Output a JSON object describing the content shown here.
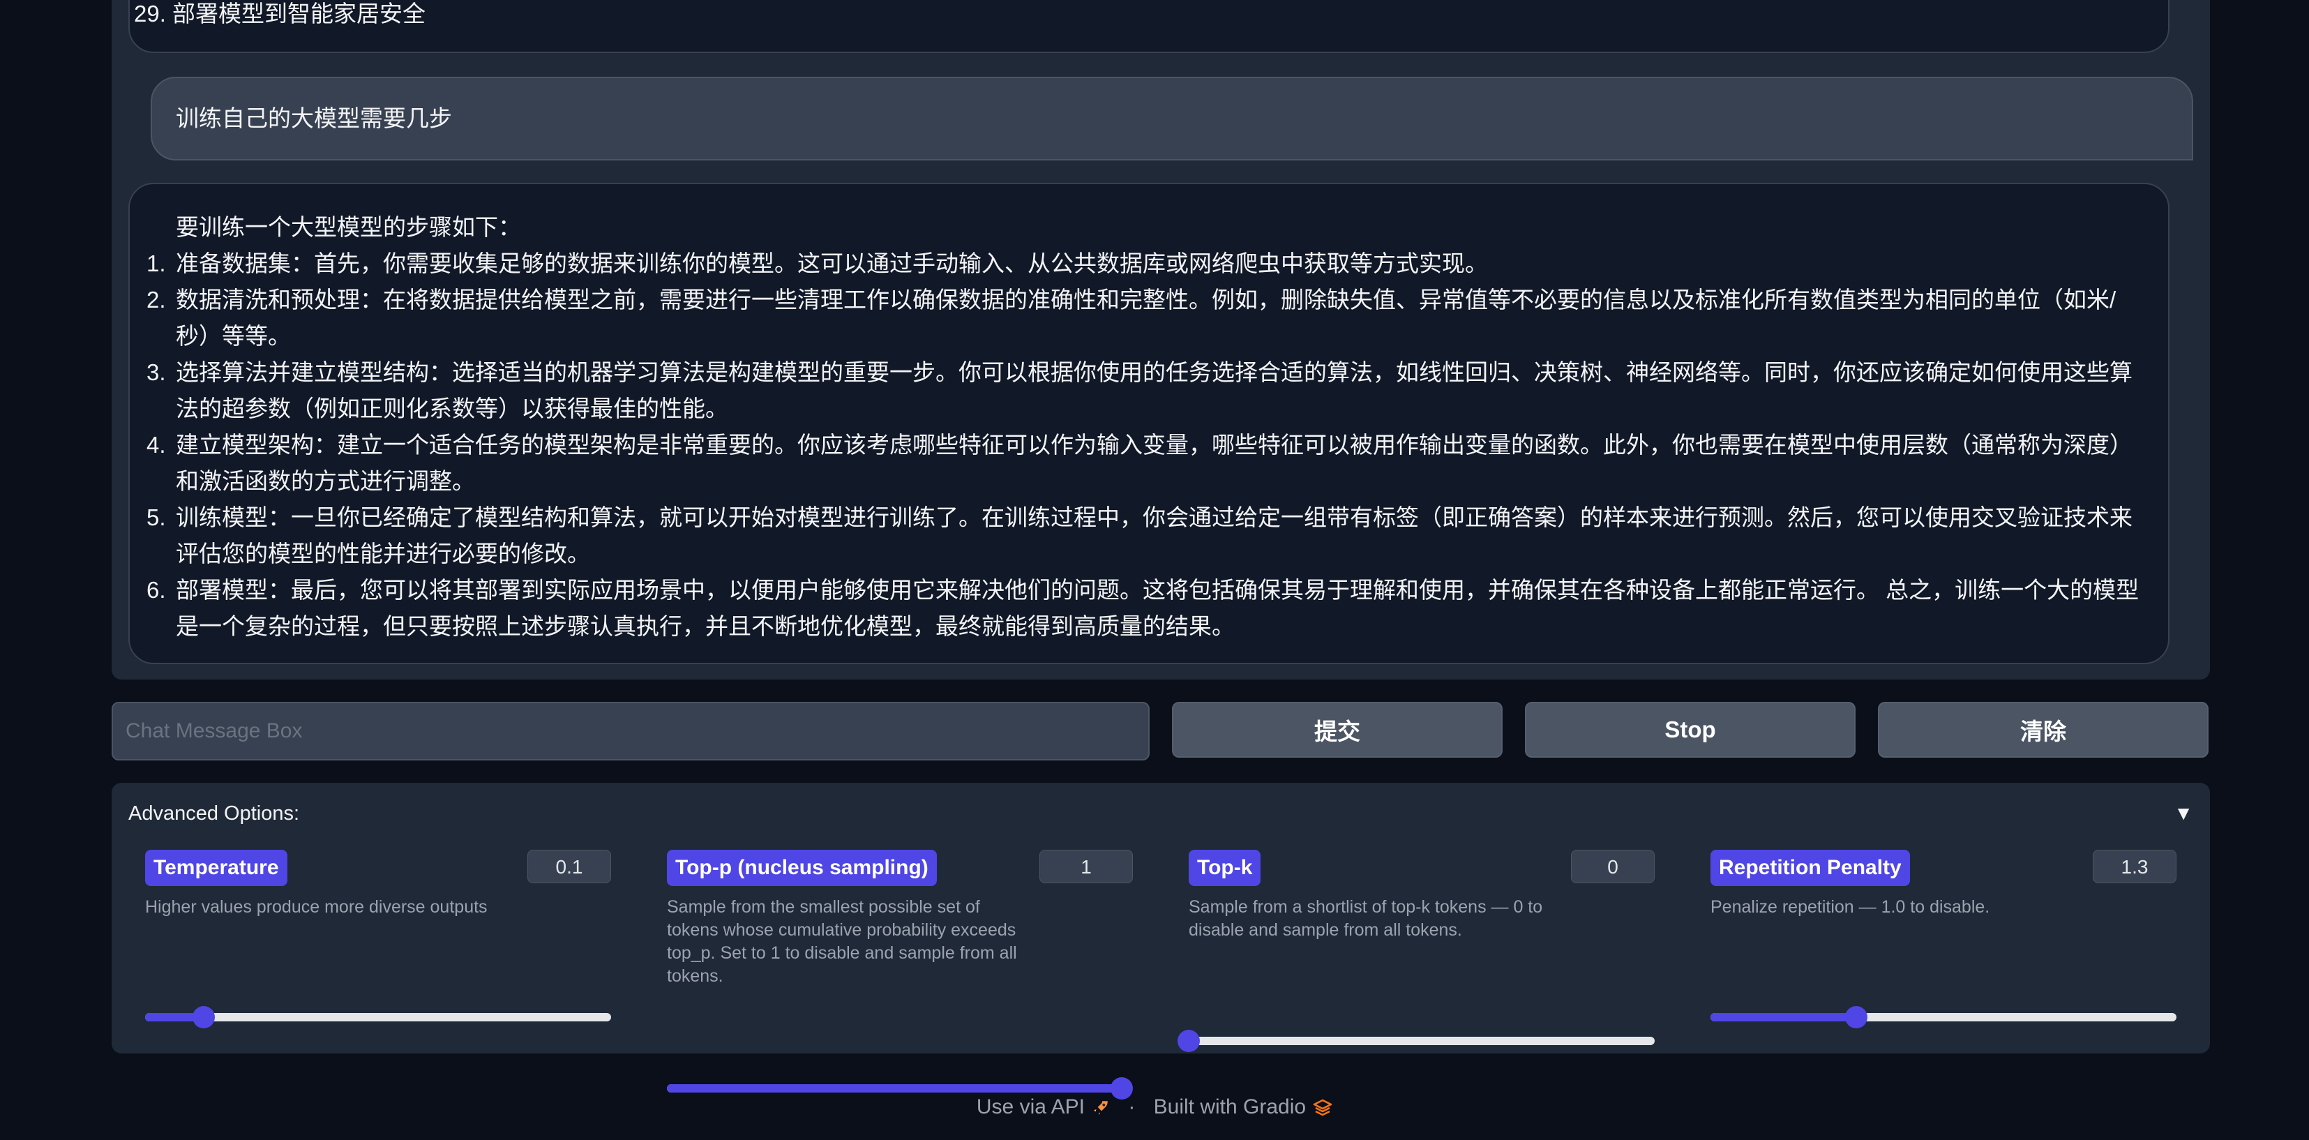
{
  "chat": {
    "prev_bot_line": "29. 部署模型到智能家居安全",
    "user_message": "训练自己的大模型需要几步",
    "bot_reply": {
      "intro": "要训练一个大型模型的步骤如下：",
      "steps": [
        {
          "num": "1.",
          "text": "准备数据集：首先，你需要收集足够的数据来训练你的模型。这可以通过手动输入、从公共数据库或网络爬虫中获取等方式实现。"
        },
        {
          "num": "2.",
          "text": "数据清洗和预处理：在将数据提供给模型之前，需要进行一些清理工作以确保数据的准确性和完整性。例如，删除缺失值、异常值等不必要的信息以及标准化所有数值类型为相同的单位（如米/秒）等等。"
        },
        {
          "num": "3.",
          "text": "选择算法并建立模型结构：选择适当的机器学习算法是构建模型的重要一步。你可以根据你使用的任务选择合适的算法，如线性回归、决策树、神经网络等。同时，你还应该确定如何使用这些算法的超参数（例如正则化系数等）以获得最佳的性能。"
        },
        {
          "num": "4.",
          "text": "建立模型架构：建立一个适合任务的模型架构是非常重要的。你应该考虑哪些特征可以作为输入变量，哪些特征可以被用作输出变量的函数。此外，你也需要在模型中使用层数（通常称为深度）和激活函数的方式进行调整。"
        },
        {
          "num": "5.",
          "text": "训练模型：一旦你已经确定了模型结构和算法，就可以开始对模型进行训练了。在训练过程中，你会通过给定一组带有标签（即正确答案）的样本来进行预测。然后，您可以使用交叉验证技术来评估您的模型的性能并进行必要的修改。"
        },
        {
          "num": "6.",
          "text": "部署模型：最后，您可以将其部署到实际应用场景中，以便用户能够使用它来解决他们的问题。这将包括确保其易于理解和使用，并确保其在各种设备上都能正常运行。 总之，训练一个大的模型是一个复杂的过程，但只要按照上述步骤认真执行，并且不断地优化模型，最终就能得到高质量的结果。"
        }
      ]
    }
  },
  "input": {
    "placeholder": "Chat Message Box",
    "value": ""
  },
  "buttons": {
    "submit": "提交",
    "stop": "Stop",
    "clear": "清除"
  },
  "advanced": {
    "title": "Advanced Options:",
    "toggle": "▼",
    "sliders": [
      {
        "key": "temperature",
        "label": "Temperature",
        "value": "0.1",
        "fraction": 0.125,
        "description": "Higher values produce more diverse outputs"
      },
      {
        "key": "top_p",
        "label": "Top-p (nucleus sampling)",
        "value": "1",
        "fraction": 1.0,
        "description": "Sample from the smallest possible set of tokens whose cumulative probability exceeds top_p. Set to 1 to disable and sample from all tokens."
      },
      {
        "key": "top_k",
        "label": "Top-k",
        "value": "0",
        "fraction": 0.0,
        "description": "Sample from a shortlist of top-k tokens — 0 to disable and sample from all tokens."
      },
      {
        "key": "repetition_penalty",
        "label": "Repetition Penalty",
        "value": "1.3",
        "fraction": 0.3125,
        "description": "Penalize repetition — 1.0 to disable."
      }
    ]
  },
  "footer": {
    "api_link": "Use via API",
    "separator": "·",
    "built_with": "Built with Gradio"
  },
  "colors": {
    "background": "#0b0f19",
    "panel": "#1f2937",
    "accent": "#4f46e5",
    "gradio_orange": "#f97316"
  }
}
